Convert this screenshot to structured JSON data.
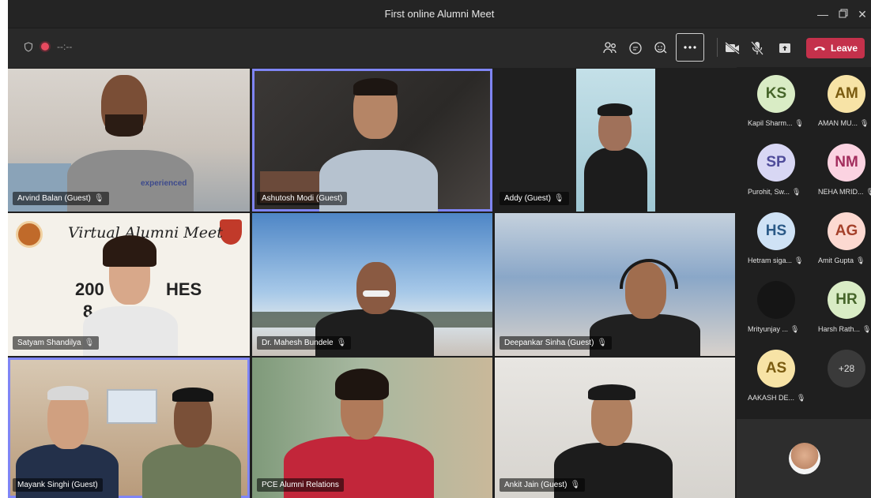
{
  "window": {
    "title": "First online Alumni Meet"
  },
  "toolbar": {
    "timer": "--:--",
    "leave_label": "Leave",
    "icons": [
      "people-icon",
      "chat-icon",
      "reactions-icon",
      "more-icon",
      "camera-off-icon",
      "mic-off-icon",
      "share-icon",
      "phone-icon"
    ]
  },
  "participants": [
    {
      "name": "Arvind Balan (Guest)",
      "shirt_text": "experienced"
    },
    {
      "name": "Ashutosh Modi (Guest)"
    },
    {
      "name": "Addy (Guest)"
    },
    {
      "name": "Satyam Shandilya",
      "banner_title": "Virtual Alumni Meet",
      "banner_line1": "200",
      "banner_line1b": "HES",
      "banner_line2": "8"
    },
    {
      "name": "Dr. Mahesh Bundele"
    },
    {
      "name": "Deepankar Sinha (Guest)"
    },
    {
      "name": "Mayank Singhi (Guest)"
    },
    {
      "name": "PCE Alumni Relations"
    },
    {
      "name": "Ankit Jain (Guest)"
    }
  ],
  "roster": [
    {
      "initials": "KS",
      "name": "Kapil Sharm...",
      "bg": "#d9ecc5",
      "fg": "#46652a"
    },
    {
      "initials": "AM",
      "name": "AMAN MU...",
      "bg": "#f7e3a6",
      "fg": "#7a5b10"
    },
    {
      "initials": "SP",
      "name": "Purohit, Sw...",
      "bg": "#d8d7f4",
      "fg": "#4f4c9a"
    },
    {
      "initials": "NM",
      "name": "NEHA MRID...",
      "bg": "#fbd3e1",
      "fg": "#a32d5d"
    },
    {
      "initials": "HS",
      "name": "Hetram siga...",
      "bg": "#cfe2f5",
      "fg": "#2b5a87"
    },
    {
      "initials": "AG",
      "name": "Amit Gupta",
      "bg": "#fcd9d1",
      "fg": "#a5412b"
    },
    {
      "initials": "",
      "name": "Mrityunjay ...",
      "bg": "#151515",
      "fg": "#ffffff"
    },
    {
      "initials": "HR",
      "name": "Harsh Rath...",
      "bg": "#d9ecc5",
      "fg": "#46652a"
    },
    {
      "initials": "AS",
      "name": "AAKASH DE...",
      "bg": "#f7e3a6",
      "fg": "#7a5b10"
    },
    {
      "initials": "+28",
      "name": "",
      "bg": "#3a3a3a",
      "fg": "#e0e0e0"
    }
  ],
  "colors": {
    "accent": "#7f85f5",
    "leave": "#c4314b"
  }
}
